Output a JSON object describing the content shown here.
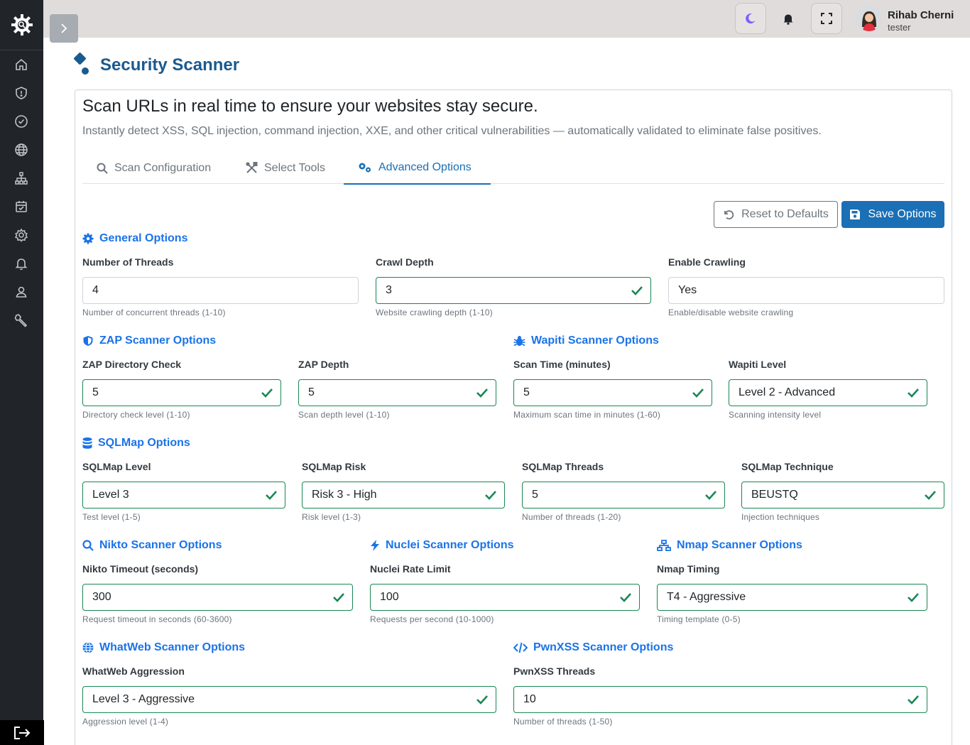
{
  "user": {
    "name": "Rihab Cherni",
    "role": "tester"
  },
  "page": {
    "title": "Security Scanner",
    "headline": "Scan URLs in real time to ensure your websites stay secure.",
    "subline": "Instantly detect XSS, SQL injection, command injection, XXE, and other critical vulnerabilities — automatically validated to eliminate false positives."
  },
  "tabs": [
    {
      "label": "Scan Configuration",
      "icon": "search-icon"
    },
    {
      "label": "Select Tools",
      "icon": "tools-icon"
    },
    {
      "label": "Advanced Options",
      "icon": "cogs-icon",
      "active": true
    }
  ],
  "actions": {
    "reset_label": "Reset to Defaults",
    "save_label": "Save Options"
  },
  "sections": {
    "general": {
      "title": "General Options",
      "threads": {
        "label": "Number of Threads",
        "value": "4",
        "help": "Number of concurrent threads (1-10)"
      },
      "crawl_depth": {
        "label": "Crawl Depth",
        "value": "3",
        "help": "Website crawling depth (1-10)"
      },
      "crawling": {
        "label": "Enable Crawling",
        "value": "Yes",
        "help": "Enable/disable website crawling"
      }
    },
    "zap": {
      "title": "ZAP Scanner Options",
      "dir_check": {
        "label": "ZAP Directory Check",
        "value": "5",
        "help": "Directory check level (1-10)"
      },
      "depth": {
        "label": "ZAP Depth",
        "value": "5",
        "help": "Scan depth level (1-10)"
      }
    },
    "wapiti": {
      "title": "Wapiti Scanner Options",
      "scan_time": {
        "label": "Scan Time (minutes)",
        "value": "5",
        "help": "Maximum scan time in minutes (1-60)"
      },
      "level": {
        "label": "Wapiti Level",
        "value": "Level 2 - Advanced",
        "help": "Scanning intensity level"
      }
    },
    "sqlmap": {
      "title": "SQLMap Options",
      "level": {
        "label": "SQLMap Level",
        "value": "Level 3",
        "help": "Test level (1-5)"
      },
      "risk": {
        "label": "SQLMap Risk",
        "value": "Risk 3 - High",
        "help": "Risk level (1-3)"
      },
      "threads": {
        "label": "SQLMap Threads",
        "value": "5",
        "help": "Number of threads (1-20)"
      },
      "technique": {
        "label": "SQLMap Technique",
        "value": "BEUSTQ",
        "help": "Injection techniques"
      }
    },
    "nikto": {
      "title": "Nikto Scanner Options",
      "timeout": {
        "label": "Nikto Timeout (seconds)",
        "value": "300",
        "help": "Request timeout in seconds (60-3600)"
      }
    },
    "nuclei": {
      "title": "Nuclei Scanner Options",
      "rate": {
        "label": "Nuclei Rate Limit",
        "value": "100",
        "help": "Requests per second (10-1000)"
      }
    },
    "nmap": {
      "title": "Nmap Scanner Options",
      "timing": {
        "label": "Nmap Timing",
        "value": "T4 - Aggressive",
        "help": "Timing template (0-5)"
      }
    },
    "whatweb": {
      "title": "WhatWeb Scanner Options",
      "aggression": {
        "label": "WhatWeb Aggression",
        "value": "Level 3 - Aggressive",
        "help": "Aggression level (1-4)"
      }
    },
    "pwnxss": {
      "title": "PwnXSS Scanner Options",
      "threads": {
        "label": "PwnXSS Threads",
        "value": "10",
        "help": "Number of threads (1-50)"
      }
    }
  },
  "colors": {
    "accent": "#1a6fb5",
    "link": "#1a73e8",
    "valid": "#198754",
    "sidebar": "#212529",
    "topbar": "#e0dcdc"
  }
}
